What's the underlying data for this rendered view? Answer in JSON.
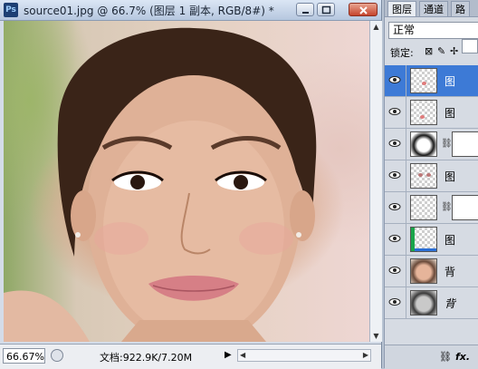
{
  "document": {
    "app_icon": "Ps",
    "title": "source01.jpg @ 66.7% (图层 1 副本, RGB/8#) *",
    "zoom": "66.67%",
    "doc_info": "文档:922.9K/7.20M"
  },
  "panel": {
    "tabs": [
      "图层",
      "通道",
      "路"
    ],
    "blend_mode": "正常",
    "lock_label": "锁定:",
    "layers": [
      {
        "name": "图",
        "selected": true
      },
      {
        "name": "图"
      },
      {
        "name": ""
      },
      {
        "name": "图"
      },
      {
        "name": ""
      },
      {
        "name": "图"
      },
      {
        "name": "背"
      },
      {
        "name": "背"
      }
    ],
    "footer_fx": "fx."
  },
  "icons": [
    "eye-icon",
    "link-icon",
    "lock-icon",
    "brush-icon",
    "fx-icon",
    "chain-icon",
    "triangle-right-icon"
  ]
}
